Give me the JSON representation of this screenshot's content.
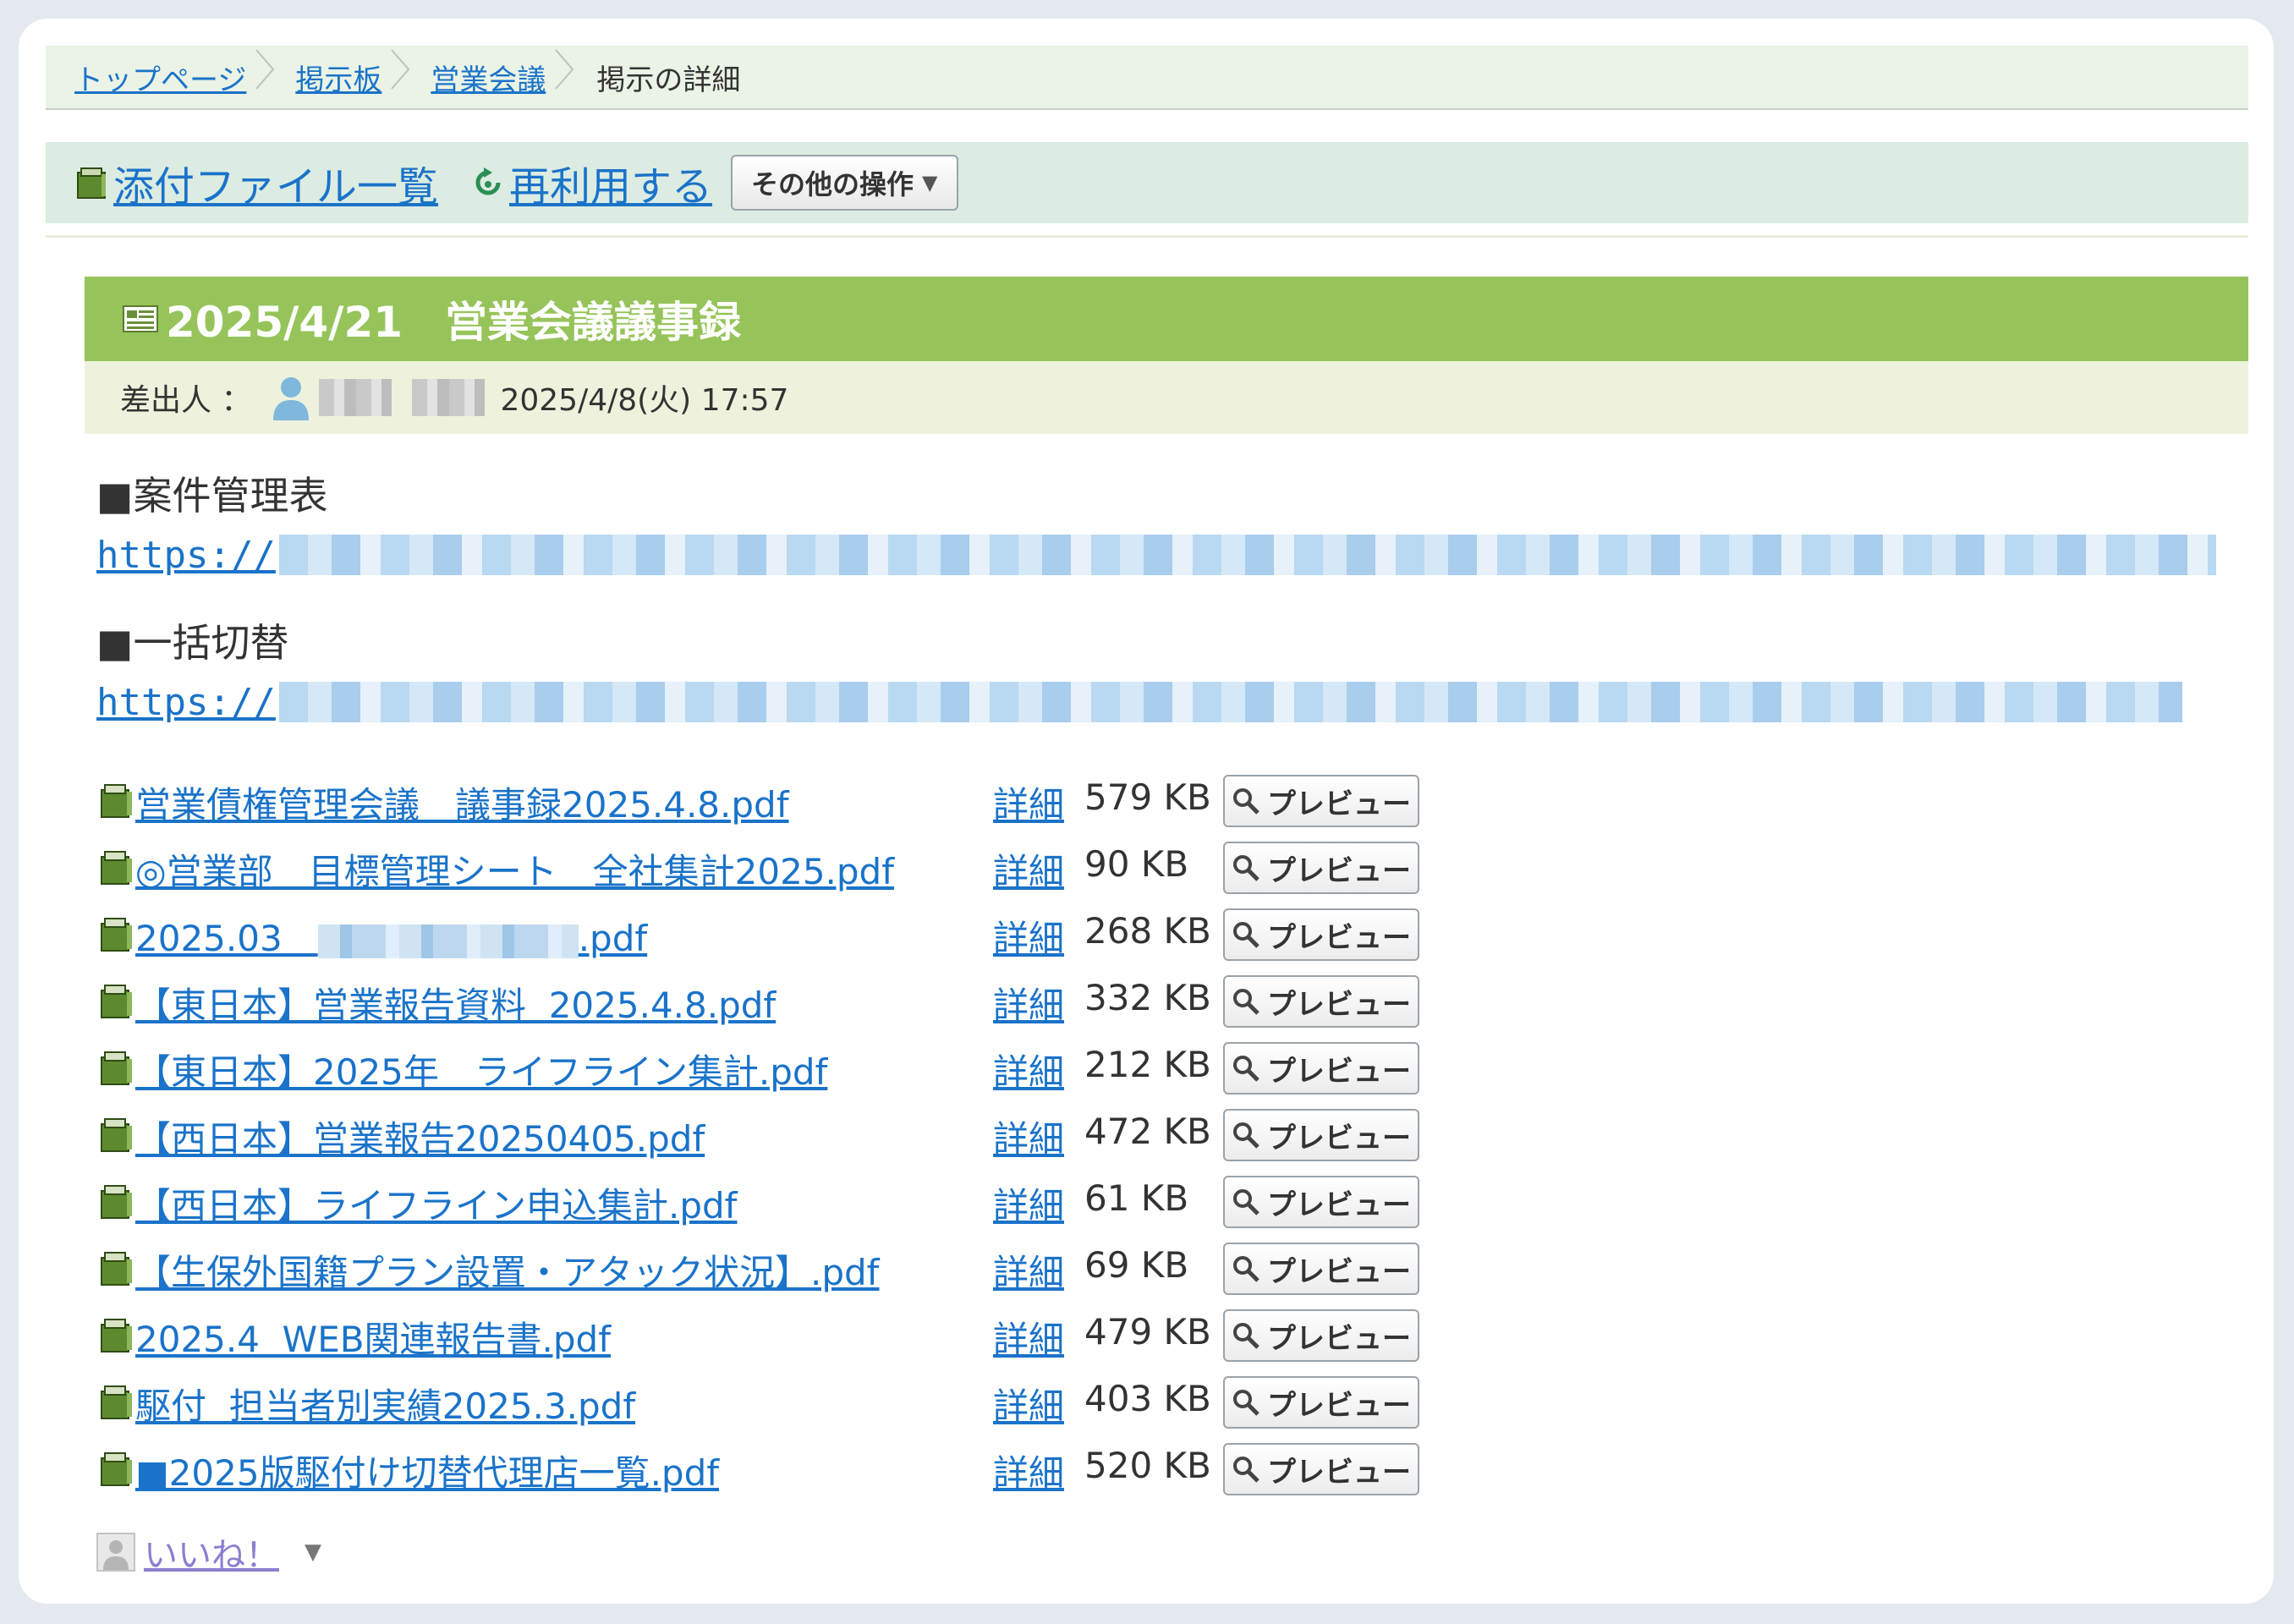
{
  "breadcrumb": {
    "items": [
      "トップページ",
      "掲示板",
      "営業会議"
    ],
    "current": "掲示の詳細"
  },
  "toolbar": {
    "attachments_label": "添付ファイル一覧",
    "reuse_label": "再利用する",
    "other_ops_label": "その他の操作",
    "caret": "▼"
  },
  "post": {
    "title": "2025/4/21　営業会議議事録",
    "sender_label": "差出人 ：",
    "datetime": "2025/4/8(火) 17:57"
  },
  "content": {
    "section1_heading": "■案件管理表",
    "section1_url_prefix": "https://",
    "section2_heading": "■一括切替",
    "section2_url_prefix": "https://"
  },
  "attachments": {
    "detail_label": "詳細",
    "preview_label": "プレビュー",
    "files": [
      {
        "name": "営業債権管理会議　議事録2025.4.8.pdf",
        "size": "579 KB"
      },
      {
        "name": "◎営業部　目標管理シート　全社集計2025.pdf",
        "size": "90 KB"
      },
      {
        "name": "2025.03　",
        "suffix": ".pdf",
        "size": "268 KB"
      },
      {
        "name": "【東日本】営業報告資料  2025.4.8.pdf",
        "size": "332 KB"
      },
      {
        "name": "【東日本】2025年　ライフライン集計.pdf",
        "size": "212 KB"
      },
      {
        "name": "【西日本】営業報告20250405.pdf",
        "size": "472 KB"
      },
      {
        "name": "【西日本】ライフライン申込集計.pdf",
        "size": "61 KB"
      },
      {
        "name": "【生保外国籍プラン設置・アタック状況】.pdf",
        "size": "69 KB"
      },
      {
        "name": "2025.4  WEB関連報告書.pdf",
        "size": "479 KB"
      },
      {
        "name": "駆付  担当者別実績2025.3.pdf",
        "size": "403 KB"
      },
      {
        "name": "■2025版駆付け切替代理店一覧.pdf",
        "size": "520 KB"
      }
    ]
  },
  "like": {
    "label": "いいね！",
    "caret": "▼"
  },
  "colors": {
    "link": "#1a73c9",
    "title_bar": "#96c45a",
    "sender_bar": "#eef2dd",
    "toolbar": "#dcece2",
    "breadcrumb": "#eaf3e6"
  }
}
